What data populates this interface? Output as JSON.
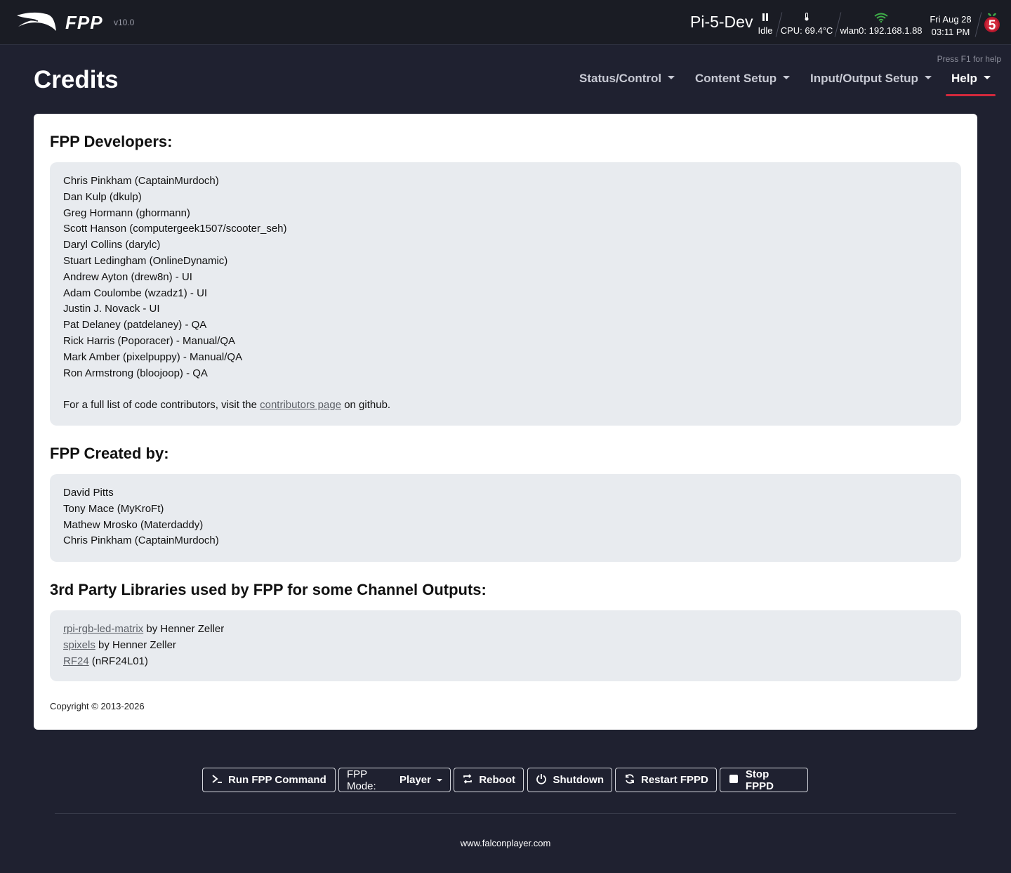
{
  "header": {
    "brand": "FPP",
    "version": "v10.0",
    "hostname": "Pi-5-Dev",
    "status_icon": "pause-icon",
    "status": "Idle",
    "cpu": "CPU: 69.4°C",
    "network": "wlan0: 192.168.1.88",
    "date": "Fri Aug 28",
    "time": "03:11 PM",
    "pi_model": "5"
  },
  "help_hint": "Press F1 for help",
  "page_title": "Credits",
  "nav": {
    "items": [
      {
        "label": "Status/Control"
      },
      {
        "label": "Content Setup"
      },
      {
        "label": "Input/Output Setup"
      },
      {
        "label": "Help"
      }
    ],
    "active": "Help"
  },
  "developers": {
    "title": "FPP Developers:",
    "names": [
      "Chris Pinkham (CaptainMurdoch)",
      "Dan Kulp (dkulp)",
      "Greg Hormann (ghormann)",
      "Scott Hanson (computergeek1507/scooter_seh)",
      "Daryl Collins (darylc)",
      "Stuart Ledingham (OnlineDynamic)",
      "Andrew Ayton (drew8n) - UI",
      "Adam Coulombe (wzadz1) - UI",
      "Justin J. Novack - UI",
      "Pat Delaney (patdelaney) - QA",
      "Rick Harris (Poporacer) - Manual/QA",
      "Mark Amber (pixelpuppy) - Manual/QA",
      "Ron Armstrong (bloojoop) - QA"
    ],
    "contrib_prefix": "For a full list of code contributors, visit the ",
    "contrib_link": "contributors page",
    "contrib_suffix": " on github."
  },
  "creators": {
    "title": "FPP Created by:",
    "names": [
      "David Pitts",
      "Tony Mace (MyKroFt)",
      "Mathew Mrosko (Materdaddy)",
      "Chris Pinkham (CaptainMurdoch)"
    ]
  },
  "libraries": {
    "title": "3rd Party Libraries used by FPP for some Channel Outputs:",
    "items": [
      {
        "link": "rpi-rgb-led-matrix",
        "text": " by Henner Zeller"
      },
      {
        "link": "spixels",
        "text": " by Henner Zeller"
      },
      {
        "link": "RF24",
        "text": " (nRF24L01)"
      }
    ]
  },
  "copyright": "Copyright © 2013-2026",
  "buttons": {
    "run_command": "Run FPP Command",
    "mode_prefix": "FPP Mode:",
    "mode_value": "Player",
    "reboot": "Reboot",
    "shutdown": "Shutdown",
    "restart": "Restart FPPD",
    "stop": "Stop FPPD"
  },
  "footer_link": "www.falconplayer.com",
  "colors": {
    "background": "#1f2130",
    "topbar": "#1a1c24",
    "accent_red": "#d2293c",
    "wifi_green": "#3fae49",
    "card": "#ffffff",
    "box": "#e8ebef"
  }
}
